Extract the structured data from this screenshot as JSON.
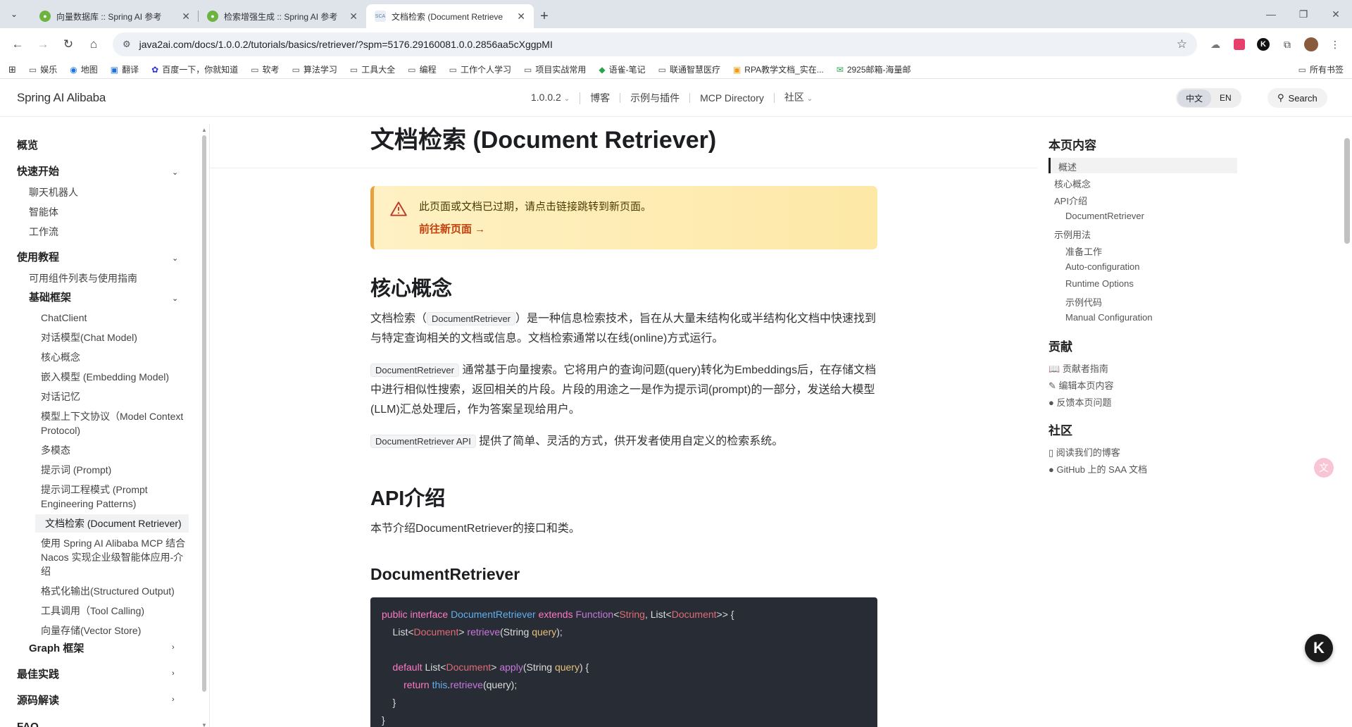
{
  "browser": {
    "tabs": [
      {
        "title": "向量数据库 :: Spring AI 参考",
        "active": false
      },
      {
        "title": "检索增强生成 :: Spring AI 参考",
        "active": false
      },
      {
        "title": "文档检索 (Document Retrieve",
        "active": true,
        "favicon_text": "SCA"
      }
    ],
    "url": "java2ai.com/docs/1.0.0.2/tutorials/basics/retriever/?spm=5176.29160081.0.0.2856aa5cXggpMI",
    "bookmarks": [
      "娱乐",
      "地图",
      "翻译",
      "百度一下，你就知道",
      "软考",
      "算法学习",
      "工具大全",
      "编程",
      "工作个人学习",
      "项目实战常用",
      "语雀-笔记",
      "联通智慧医疗",
      "RPA教学文档_实在...",
      "2925邮箱-海量邮"
    ],
    "bookmarks_right": "所有书签"
  },
  "site": {
    "logo": "Spring AI Alibaba",
    "nav": [
      "1.0.0.2",
      "博客",
      "示例与插件",
      "MCP Directory",
      "社区"
    ],
    "lang": [
      "中文",
      "EN"
    ],
    "search_label": "Search"
  },
  "sidebar": {
    "overview": "概览",
    "quickstart": "快速开始",
    "quickstart_items": [
      "聊天机器人",
      "智能体",
      "工作流"
    ],
    "tutorial": "使用教程",
    "components": "可用组件列表与使用指南",
    "basics": "基础框架",
    "basics_items": [
      "ChatClient",
      "对话模型(Chat Model)",
      "核心概念",
      "嵌入模型 (Embedding Model)",
      "对话记忆",
      "模型上下文协议（Model Context Protocol)",
      "多模态",
      "提示词 (Prompt)",
      "提示词工程模式 (Prompt Engineering Patterns)",
      "文档检索 (Document Retriever)",
      "使用 Spring AI Alibaba MCP 结合 Nacos 实现企业级智能体应用-介绍",
      "格式化输出(Structured Output)",
      "工具调用（Tool Calling)",
      "向量存储(Vector Store)"
    ],
    "graph": "Graph 框架",
    "best": "最佳实践",
    "source": "源码解读",
    "faq": "FAQ"
  },
  "main": {
    "title": "文档检索 (Document Retriever)",
    "notice_msg": "此页面或文档已过期，请点击链接跳转到新页面。",
    "notice_link": "前往新页面 →",
    "h_core": "核心概念",
    "p1_a": "文档检索（",
    "p1_code": "DocumentRetriever",
    "p1_b": "）是一种信息检索技术，旨在从大量未结构化或半结构化文档中快速找到与特定查询相关的文档或信息。文档检索通常以在线(online)方式运行。",
    "p2_code": "DocumentRetriever",
    "p2_b": " 通常基于向量搜索。它将用户的查询问题(query)转化为Embeddings后，在存储文档中进行相似性搜索，返回相关的片段。片段的用途之一是作为提示词(prompt)的一部分，发送给大模型(LLM)汇总处理后，作为答案呈现给用户。",
    "p3_code": "DocumentRetriever API",
    "p3_b": " 提供了简单、灵活的方式，供开发者使用自定义的检索系统。",
    "h_api": "API介绍",
    "p4": "本节介绍DocumentRetriever的接口和类。",
    "h_dr": "DocumentRetriever"
  },
  "toc": {
    "title": "本页内容",
    "items": [
      "概述",
      "核心概念",
      "API介绍",
      "DocumentRetriever",
      "示例用法",
      "准备工作",
      "Auto-configuration",
      "Runtime Options",
      "示例代码",
      "Manual Configuration"
    ],
    "contrib_title": "贡献",
    "contrib": [
      "贡献者指南",
      "编辑本页内容",
      "反馈本页问题"
    ],
    "community_title": "社区",
    "community": [
      "阅读我们的博客",
      "GitHub 上的 SAA 文档"
    ]
  },
  "colors": {
    "accent": "#e6a23c",
    "link": "#c2410c",
    "code_bg": "#282c34"
  }
}
